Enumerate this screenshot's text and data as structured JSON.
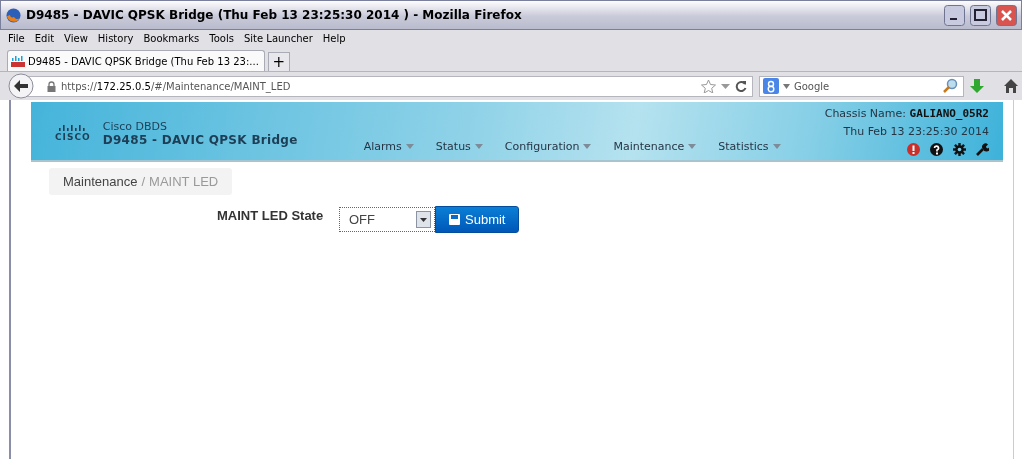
{
  "window": {
    "title": "D9485 - DAVIC QPSK Bridge (Thu Feb 13 23:25:30 2014 ) - Mozilla Firefox"
  },
  "menu": [
    "File",
    "Edit",
    "View",
    "History",
    "Bookmarks",
    "Tools",
    "Site Launcher",
    "Help"
  ],
  "tabs": [
    {
      "label": "D9485 - DAVIC QPSK Bridge (Thu Feb 13 23:...",
      "selected": true
    }
  ],
  "new_tab": "+",
  "address": {
    "scheme": "https://",
    "host": "172.25.0.5",
    "path": "/#/Maintenance/MAINT_LED"
  },
  "search": {
    "placeholder": "Google"
  },
  "header": {
    "logo_text": "CISCO",
    "brand": "Cisco DBDS",
    "product": "D9485 - DAVIC QPSK Bridge",
    "nav": [
      "Alarms",
      "Status",
      "Configuration",
      "Maintenance",
      "Statistics"
    ],
    "chassis_label": "Chassis Name:",
    "chassis_name": "GALIANO_05R2",
    "datetime": "Thu Feb 13 23:25:30 2014"
  },
  "breadcrumb": {
    "items": [
      "Maintenance",
      "MAINT LED"
    ],
    "separator": "/"
  },
  "form": {
    "label": "MAINT LED State",
    "value": "OFF",
    "button": "Submit"
  }
}
